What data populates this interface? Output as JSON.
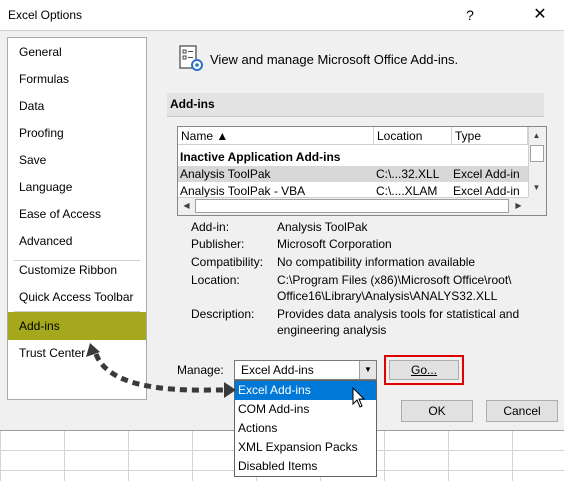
{
  "window": {
    "title": "Excel Options",
    "help_glyph": "?",
    "close_glyph": "✕"
  },
  "nav": {
    "items": [
      {
        "label": "General"
      },
      {
        "label": "Formulas"
      },
      {
        "label": "Data"
      },
      {
        "label": "Proofing"
      },
      {
        "label": "Save"
      },
      {
        "label": "Language"
      },
      {
        "label": "Ease of Access"
      },
      {
        "label": "Advanced"
      },
      {
        "label": "Customize Ribbon"
      },
      {
        "label": "Quick Access Toolbar"
      },
      {
        "label": "Add-ins"
      },
      {
        "label": "Trust Center"
      }
    ],
    "selected": "Add-ins",
    "selected_color": "#a5a81d"
  },
  "main": {
    "header": "View and manage Microsoft Office Add-ins.",
    "section_title": "Add-ins",
    "table": {
      "columns": [
        "Name ▲",
        "Location",
        "Type"
      ],
      "group_label": "Inactive Application Add-ins",
      "rows": [
        {
          "name": "Analysis ToolPak",
          "location": "C:\\...32.XLL",
          "type": "Excel Add-in"
        },
        {
          "name": "Analysis ToolPak - VBA",
          "location": "C:\\....XLAM",
          "type": "Excel Add-in"
        }
      ]
    },
    "details": {
      "addin_label": "Add-in:",
      "addin": "Analysis ToolPak",
      "publisher_label": "Publisher:",
      "publisher": "Microsoft Corporation",
      "compat_label": "Compatibility:",
      "compat": "No compatibility information available",
      "location_label": "Location:",
      "location_line1": "C:\\Program Files (x86)\\Microsoft Office\\root\\",
      "location_line2": "Office16\\Library\\Analysis\\ANALYS32.XLL",
      "desc_label": "Description:",
      "desc_line1": "Provides data analysis tools for statistical and",
      "desc_line2": "engineering analysis"
    },
    "manage": {
      "label": "Manage:",
      "selected": "Excel Add-ins",
      "options": [
        "Excel Add-ins",
        "COM Add-ins",
        "Actions",
        "XML Expansion Packs",
        "Disabled Items"
      ],
      "go_label": "Go...",
      "highlight_color": "#e00000"
    }
  },
  "buttons": {
    "ok": "OK",
    "cancel": "Cancel"
  },
  "colors": {
    "dropdown_selection": "#0078d7"
  }
}
